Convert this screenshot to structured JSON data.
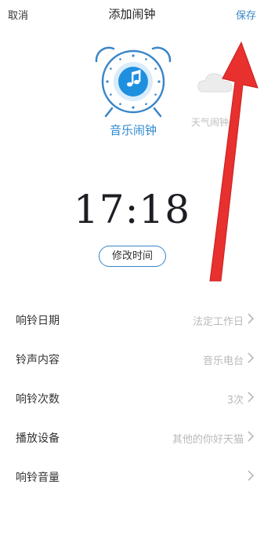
{
  "header": {
    "cancel": "取消",
    "title": "添加闹钟",
    "save": "保存"
  },
  "alarm_types": {
    "music": "音乐闹钟",
    "weather": "天气闹钟"
  },
  "time": "17:18",
  "edit_time": "修改时间",
  "settings": [
    {
      "label": "响铃日期",
      "value": "法定工作日"
    },
    {
      "label": "铃声内容",
      "value": "音乐电台"
    },
    {
      "label": "响铃次数",
      "value": "3次"
    },
    {
      "label": "播放设备",
      "value": "其他的你好天猫"
    },
    {
      "label": "响铃音量",
      "value": ""
    }
  ],
  "colors": {
    "accent": "#3a85c8",
    "annotation_arrow": "#e8302e"
  }
}
